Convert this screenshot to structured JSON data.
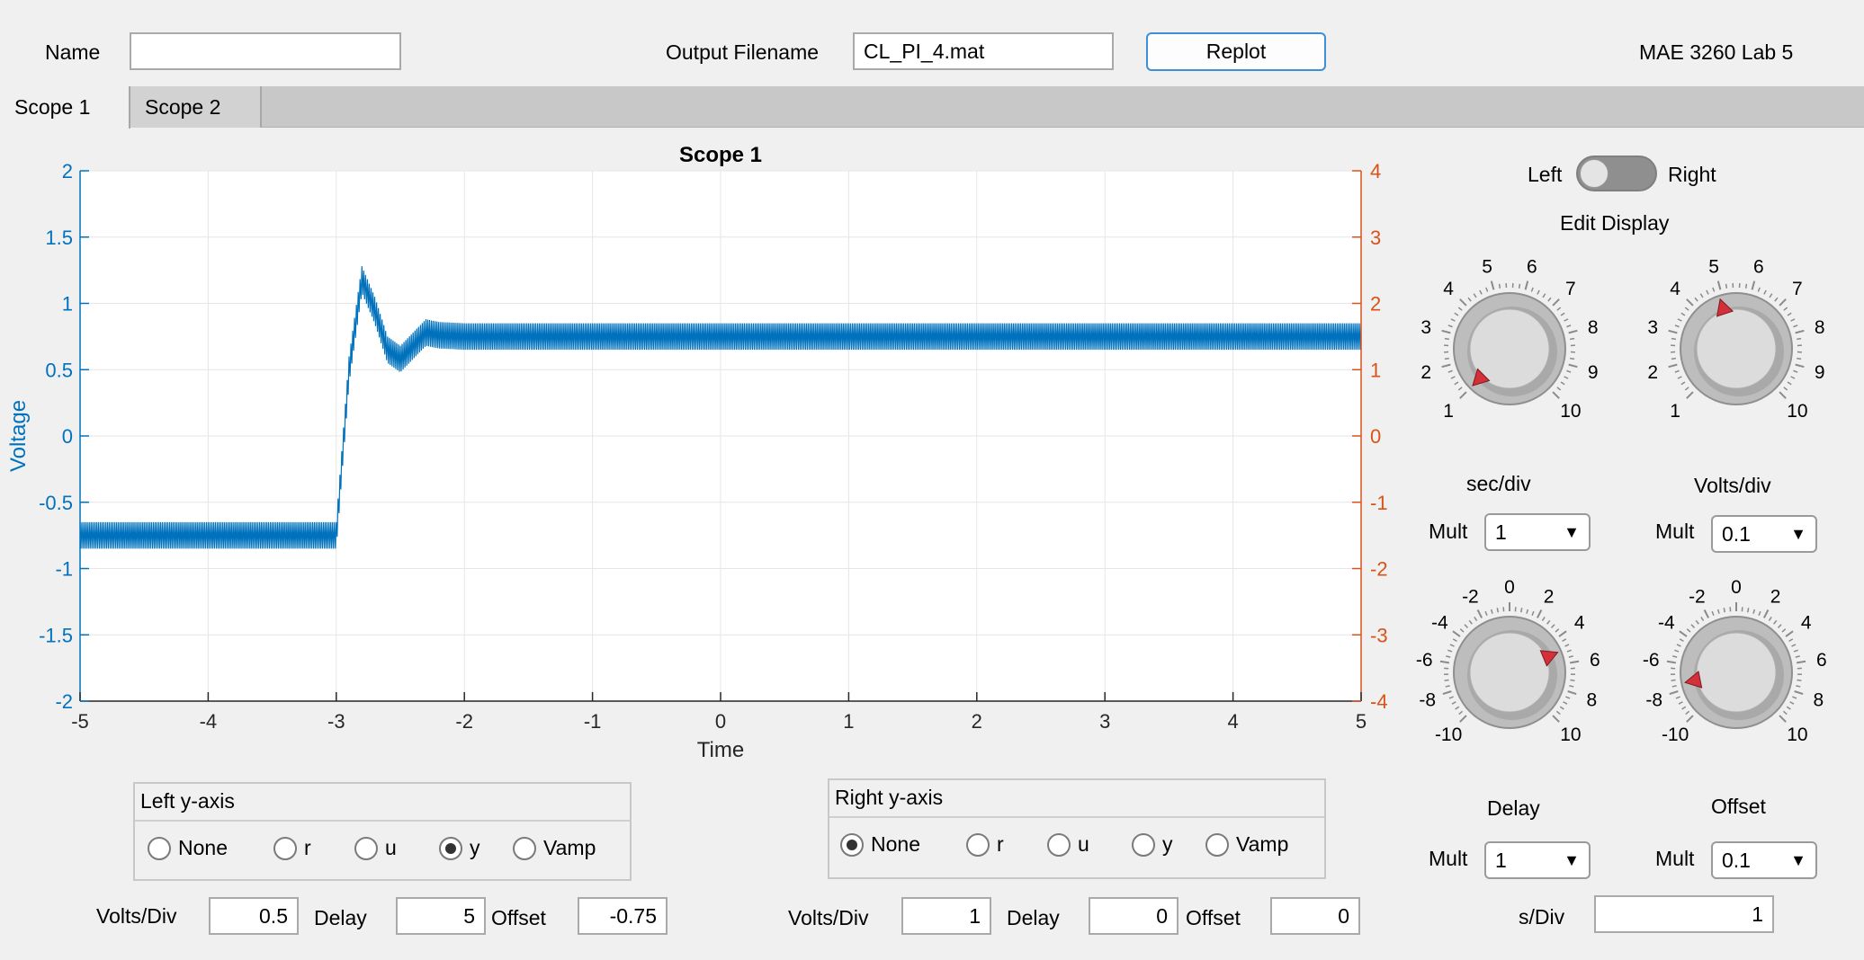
{
  "header": {
    "name_label": "Name",
    "name_value": "",
    "output_label": "Output Filename",
    "output_value": "CL_PI_4.mat",
    "replot_label": "Replot",
    "app_title": "MAE 3260 Lab 5"
  },
  "tabs": [
    {
      "label": "Scope 1",
      "active": true
    },
    {
      "label": "Scope 2",
      "active": false
    }
  ],
  "chart_data": {
    "type": "line",
    "title": "Scope 1",
    "xlabel": "Time",
    "ylabel": "Voltage",
    "xlim": [
      -5,
      5
    ],
    "ylim_left": [
      -2,
      2
    ],
    "ylim_right": [
      -4,
      4
    ],
    "x_ticks": [
      "-5",
      "-4",
      "-3",
      "-2",
      "-1",
      "0",
      "1",
      "2",
      "3",
      "4",
      "5"
    ],
    "y_ticks_left": [
      "2",
      "1.5",
      "1",
      "0.5",
      "0",
      "-0.5",
      "-1",
      "-1.5",
      "-2"
    ],
    "y_ticks_right": [
      "4",
      "3",
      "2",
      "1",
      "0",
      "-1",
      "-2",
      "-3",
      "-4"
    ],
    "grid": true,
    "left_axis_color": "#0072bd",
    "right_axis_color": "#d95319",
    "series": [
      {
        "color": "#0072bd",
        "x": [
          -5,
          -4,
          -3.1,
          -3.0,
          -2.9,
          -2.8,
          -2.7,
          -2.6,
          -2.5,
          -2.4,
          -2.3,
          -2.2,
          -2.0,
          -1,
          0,
          1,
          2,
          3,
          4,
          5
        ],
        "y": [
          -0.75,
          -0.75,
          -0.75,
          -0.75,
          0.5,
          1.18,
          0.95,
          0.65,
          0.58,
          0.68,
          0.78,
          0.76,
          0.75,
          0.75,
          0.75,
          0.75,
          0.75,
          0.75,
          0.75,
          0.75
        ],
        "noise_amplitude": 0.1
      }
    ]
  },
  "left_axis": {
    "title": "Left y-axis",
    "options": [
      "None",
      "r",
      "u",
      "y",
      "Vamp"
    ],
    "selected": "y",
    "volts_div_label": "Volts/Div",
    "volts_div": "0.5",
    "delay_label": "Delay",
    "delay": "5",
    "offset_label": "Offset",
    "offset": "-0.75"
  },
  "right_axis": {
    "title": "Right y-axis",
    "options": [
      "None",
      "r",
      "u",
      "y",
      "Vamp"
    ],
    "selected": "None",
    "volts_div_label": "Volts/Div",
    "volts_div": "1",
    "delay_label": "Delay",
    "delay": "0",
    "offset_label": "Offset",
    "offset": "0"
  },
  "controls": {
    "toggle_left": "Left",
    "toggle_right": "Right",
    "edit_display": "Edit Display",
    "knob_sec_div": {
      "label": "sec/div",
      "ticks": [
        "1",
        "2",
        "3",
        "4",
        "5",
        "6",
        "7",
        "8",
        "9",
        "10"
      ],
      "value": 1
    },
    "knob_volts_div": {
      "label": "Volts/div",
      "ticks": [
        "1",
        "2",
        "3",
        "4",
        "5",
        "6",
        "7",
        "8",
        "9",
        "10"
      ],
      "value": 4.9
    },
    "knob_delay": {
      "label": "Delay",
      "ticks": [
        "-10",
        "-8",
        "-6",
        "-4",
        "-2",
        "0",
        "2",
        "4",
        "6",
        "8",
        "10"
      ],
      "value": 5
    },
    "knob_offset": {
      "label": "Offset",
      "ticks": [
        "-10",
        "-8",
        "-6",
        "-4",
        "-2",
        "0",
        "2",
        "4",
        "6",
        "8",
        "10"
      ],
      "value": -7.5
    },
    "mult_label": "Mult",
    "sec_div_mult": "1",
    "volts_div_mult": "0.1",
    "delay_mult": "1",
    "offset_mult": "0.1",
    "s_div_label": "s/Div",
    "s_div_value": "1"
  }
}
